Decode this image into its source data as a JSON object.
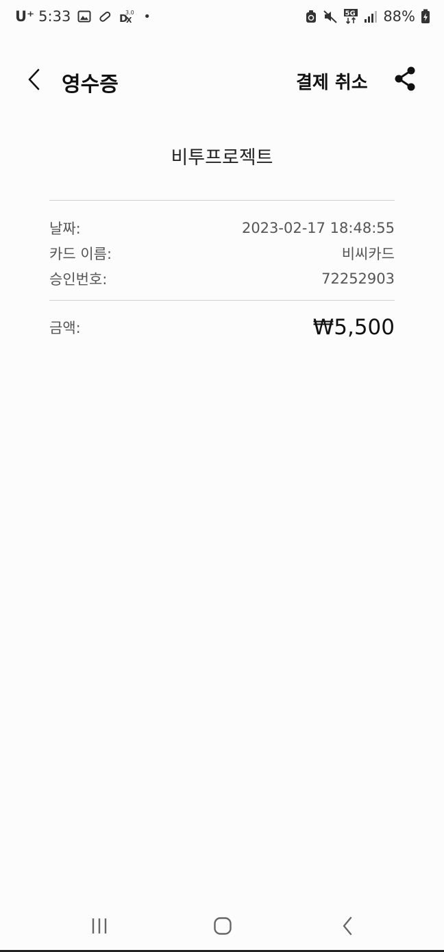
{
  "status_bar": {
    "carrier": "U⁺",
    "time": "5:33",
    "network_label": "5G",
    "battery_percent": "88%",
    "icons": [
      "gallery-icon",
      "pill-icon",
      "dx-icon",
      "dot-icon",
      "recycle-icon",
      "mute-icon",
      "signal-icon",
      "battery-charging-icon"
    ]
  },
  "header": {
    "title": "영수증",
    "cancel_label": "결제 취소"
  },
  "receipt": {
    "merchant": "비투프로젝트",
    "rows": [
      {
        "label": "날짜:",
        "value": "2023-02-17 18:48:55"
      },
      {
        "label": "카드 이름:",
        "value": "비씨카드"
      },
      {
        "label": "승인번호:",
        "value": "72252903"
      }
    ],
    "amount": {
      "label": "금액:",
      "value": "₩5,500"
    }
  },
  "nav": {
    "icons": [
      "recent-apps-icon",
      "home-icon",
      "nav-back-icon"
    ]
  },
  "colors": {
    "background": "#fcfcfc",
    "divider": "#cfcfcf",
    "text_primary": "#111111",
    "text_secondary": "#555555"
  }
}
